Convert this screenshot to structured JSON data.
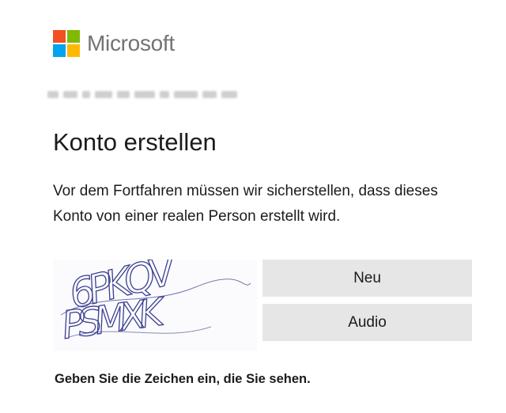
{
  "brand": {
    "name": "Microsoft",
    "logo_colors": [
      "#f25022",
      "#7fba00",
      "#00a4ef",
      "#ffb900"
    ]
  },
  "header": {
    "title": "Konto erstellen",
    "description": "Vor dem Fortfahren müssen wir sicherstellen, dass dieses Konto von einer realen Person erstellt wird."
  },
  "captcha": {
    "image_text_line1": "6PKQV",
    "image_text_line2": "PSMXK",
    "new_label": "Neu",
    "audio_label": "Audio",
    "ink_color": "#3a3f8f"
  },
  "instructions": {
    "hint": "Geben Sie die Zeichen ein, die Sie sehen."
  }
}
